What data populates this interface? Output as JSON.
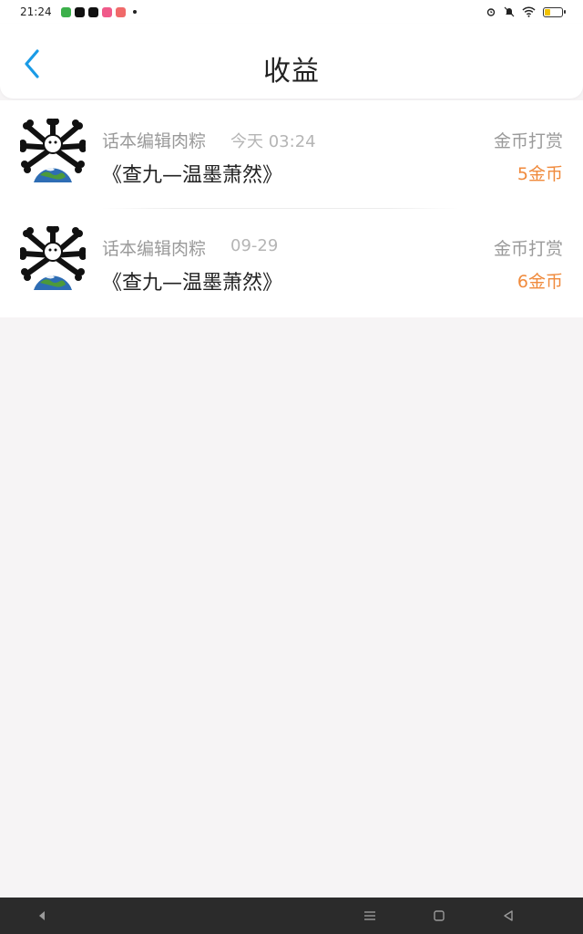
{
  "status_bar": {
    "time": "21:24",
    "notification_icons": [
      "app-icon-green",
      "tiktok-icon",
      "app-icon-black",
      "app-icon-pink",
      "app-icon-red"
    ],
    "right_icons": [
      "alarm-icon",
      "mute-icon",
      "wifi-icon",
      "battery-icon"
    ],
    "battery_level": 0.35
  },
  "header": {
    "title": "收益",
    "back_icon": "chevron-left-icon",
    "accent_color": "#1a9be6"
  },
  "rewards": [
    {
      "user": "话本编辑肉粽",
      "time": "今天 03:24",
      "book": "《查九—温墨萧然》",
      "type": "金币打赏",
      "amount": "5金币"
    },
    {
      "user": "话本编辑肉粽",
      "time": "09-29",
      "book": "《查九—温墨萧然》",
      "type": "金币打赏",
      "amount": "6金币"
    }
  ],
  "colors": {
    "amount": "#f08a3c",
    "muted_text": "#9a9a9a",
    "background": "#f6f4f5"
  },
  "nav_bar": {
    "icons": [
      "volume-down-icon",
      "menu-icon",
      "home-square-icon",
      "back-triangle-icon"
    ]
  }
}
